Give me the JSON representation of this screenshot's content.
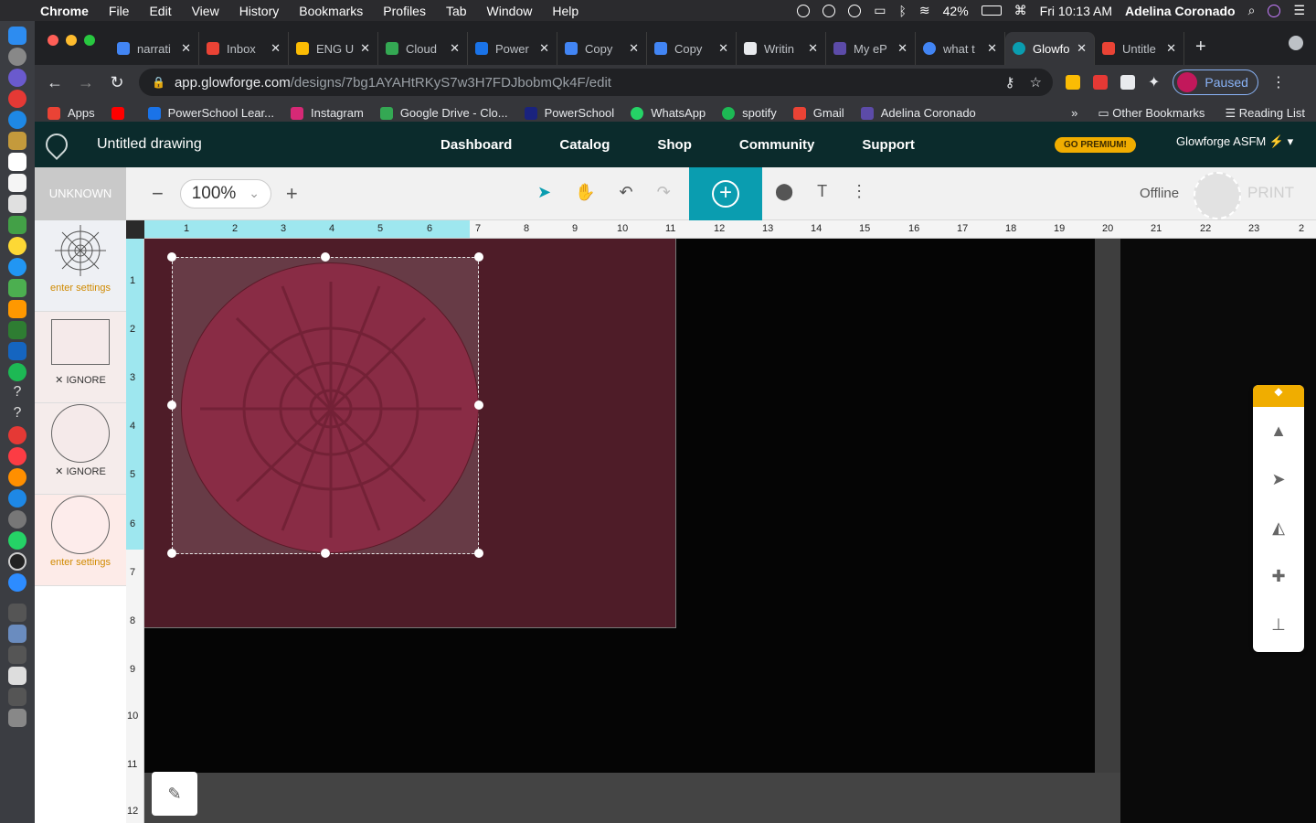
{
  "menubar": {
    "apple": "",
    "app_name": "Chrome",
    "items": [
      "File",
      "Edit",
      "View",
      "History",
      "Bookmarks",
      "Profiles",
      "Tab",
      "Window",
      "Help"
    ],
    "battery": "42%",
    "datetime": "Fri 10:13 AM",
    "user": "Adelina Coronado"
  },
  "tabs": [
    {
      "label": "narrati",
      "color": "#4285f4"
    },
    {
      "label": "Inbox",
      "color": "#ea4335"
    },
    {
      "label": "ENG U",
      "color": "#fbbc04"
    },
    {
      "label": "Cloud",
      "color": "#34a853"
    },
    {
      "label": "Power",
      "color": "#1a73e8"
    },
    {
      "label": "Copy",
      "color": "#4285f4"
    },
    {
      "label": "Copy",
      "color": "#4285f4"
    },
    {
      "label": "Writin",
      "color": "#e8eaed"
    },
    {
      "label": "My eP",
      "color": "#5c4ba8"
    },
    {
      "label": "what t",
      "color": "#4285f4"
    },
    {
      "label": "Glowfo",
      "color": "#0a9db0"
    },
    {
      "label": "Untitle",
      "color": "#ea4335"
    }
  ],
  "omnibox": {
    "host": "app.glowforge.com",
    "path": "/designs/7bg1AYAHtRKyS7w3H7FDJbobmQk4F/edit"
  },
  "profile_status": "Paused",
  "bookmarks": [
    "Apps",
    "PowerSchool Lear...",
    "Instagram",
    "Google Drive - Clo...",
    "PowerSchool",
    "WhatsApp",
    "spotify",
    "Gmail",
    "Adelina Coronado"
  ],
  "bookmarks_right": {
    "overflow": "»",
    "other": "Other Bookmarks",
    "reading": "Reading List"
  },
  "glowforge": {
    "title": "Untitled drawing",
    "nav": [
      "Dashboard",
      "Catalog",
      "Shop",
      "Community",
      "Support"
    ],
    "premium": "GO PREMIUM!",
    "account": "Glowforge ASFM",
    "material": "UNKNOWN",
    "zoom": "100%",
    "status": "Offline",
    "print": "PRINT"
  },
  "layers": [
    {
      "label": "enter settings",
      "shape": "web-icon"
    },
    {
      "label": "IGNORE",
      "shape": "square"
    },
    {
      "label": "IGNORE",
      "shape": "circle"
    },
    {
      "label": "enter settings",
      "shape": "circle"
    }
  ],
  "ruler_h": [
    "1",
    "2",
    "3",
    "4",
    "5",
    "6",
    "7",
    "8",
    "9",
    "10",
    "11",
    "12",
    "13",
    "14",
    "15",
    "16",
    "17",
    "18",
    "19",
    "20",
    "21",
    "22",
    "23",
    "2"
  ],
  "ruler_v": [
    "1",
    "2",
    "3",
    "4",
    "5",
    "6",
    "7",
    "8",
    "9",
    "10",
    "11",
    "12"
  ]
}
